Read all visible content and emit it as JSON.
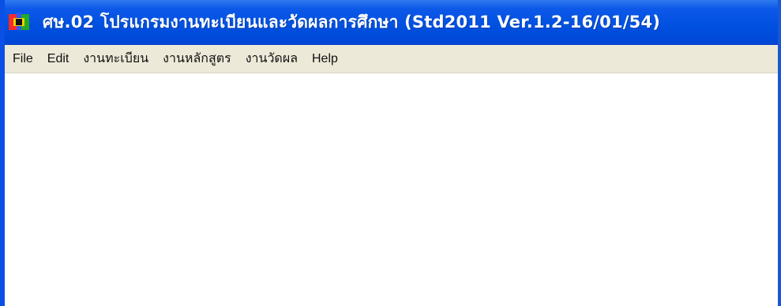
{
  "window": {
    "title": "ศษ.02 โปรแกรมงานทะเบียนและวัดผลการศึกษา (Std2011 Ver.1.2-16/01/54)"
  },
  "menu": {
    "items": [
      "File",
      "Edit",
      "งานทะเบียน",
      "งานหลักสูตร",
      "งานวัดผล",
      "Help"
    ]
  }
}
